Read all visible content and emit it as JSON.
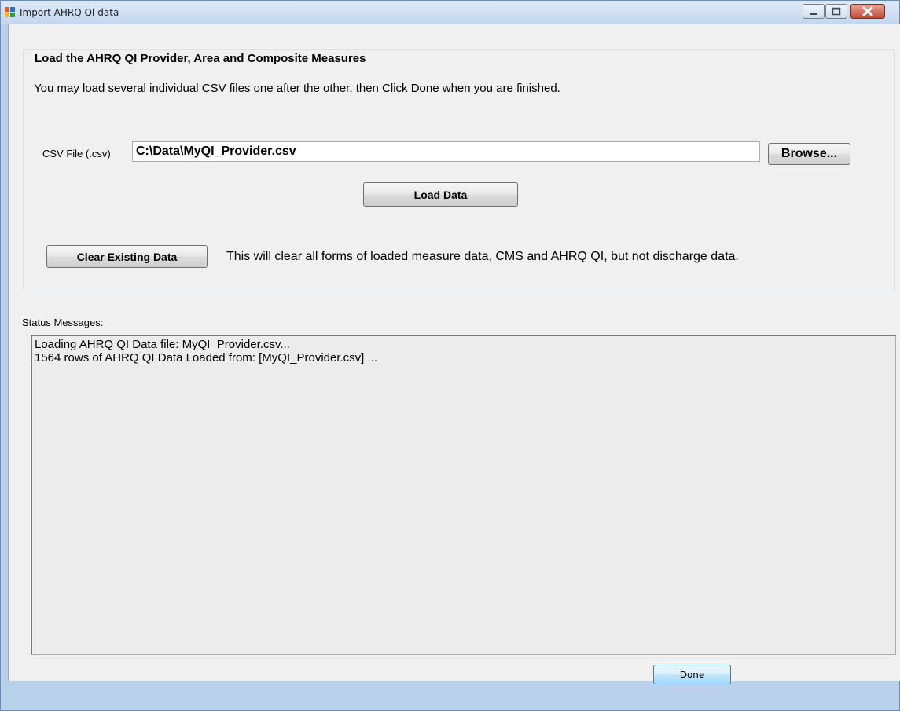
{
  "window": {
    "title": "Import AHRQ QI data",
    "icons": {
      "app": "app-icon",
      "minimize": "minimize-icon",
      "maximize": "maximize-icon",
      "close": "close-icon"
    }
  },
  "group": {
    "title": "Load the AHRQ QI Provider, Area and Composite Measures",
    "instructions": "You may load several individual CSV files one after the other, then Click Done when  you are finished."
  },
  "csv": {
    "label": "CSV File (.csv)",
    "value": "C:\\Data\\MyQI_Provider.csv",
    "browse_label": "Browse..."
  },
  "load_button": "Load Data",
  "clear": {
    "button_label": "Clear Existing Data",
    "note": "This will clear all forms of loaded measure data, CMS and AHRQ QI, but not discharge data."
  },
  "status": {
    "label": "Status Messages:",
    "messages": [
      "Loading AHRQ QI Data file: MyQI_Provider.csv...",
      "1564 rows of AHRQ QI Data Loaded from: [MyQI_Provider.csv] ..."
    ]
  },
  "done_button": "Done",
  "colors": {
    "frame": "#b9d1ea",
    "client": "#f0f0f0",
    "close_button": "#c24a33"
  }
}
